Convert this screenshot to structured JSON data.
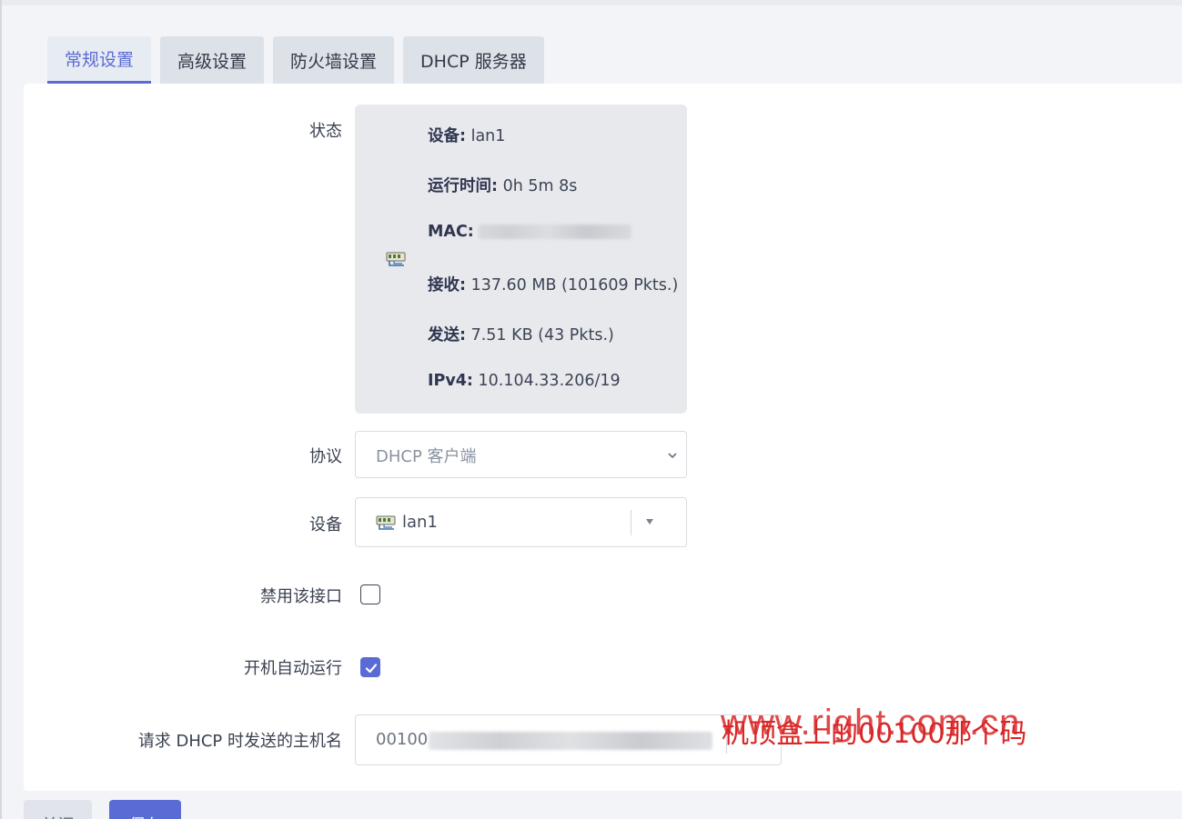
{
  "tabs": [
    {
      "label": "常规设置",
      "active": true
    },
    {
      "label": "高级设置",
      "active": false
    },
    {
      "label": "防火墙设置",
      "active": false
    },
    {
      "label": "DHCP 服务器",
      "active": false
    }
  ],
  "status": {
    "label": "状态",
    "icon": "network-port-icon",
    "device_key": "设备:",
    "device_val": "lan1",
    "uptime_key": "运行时间:",
    "uptime_val": "0h 5m 8s",
    "mac_key": "MAC:",
    "rx_key": "接收:",
    "rx_val": "137.60 MB (101609 Pkts.)",
    "tx_key": "发送:",
    "tx_val": "7.51 KB (43 Pkts.)",
    "ipv4_key": "IPv4:",
    "ipv4_val": "10.104.33.206/19"
  },
  "protocol": {
    "label": "协议",
    "value": "DHCP 客户端"
  },
  "device": {
    "label": "设备",
    "value": "lan1"
  },
  "disable_interface": {
    "label": "禁用该接口",
    "checked": false
  },
  "autostart": {
    "label": "开机自动运行",
    "checked": true
  },
  "hostname": {
    "label": "请求 DHCP 时发送的主机名",
    "value": "00100"
  },
  "watermark": "www.right.com.cn",
  "annotation": "机顶盒上的00100那个码",
  "buttons": {
    "close": "关闭",
    "save": "保存"
  },
  "colors": {
    "accent": "#5b6bd5",
    "annotation": "#d92626"
  }
}
